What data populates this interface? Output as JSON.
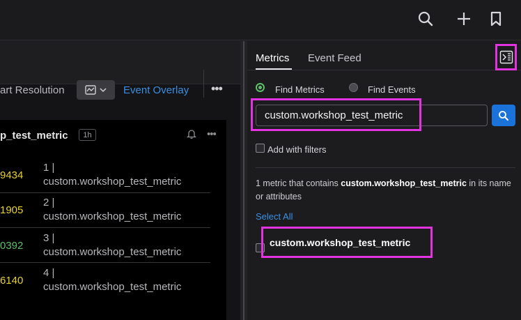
{
  "colors": {
    "accent_blue": "#1b73d9",
    "link_blue": "#3b8fe3",
    "highlight_magenta": "#e233e0",
    "value_yellow": "#e6d12a",
    "value_green": "#5fbf6a"
  },
  "topbar": {
    "icons": [
      "search-icon",
      "plus-icon",
      "bookmark-icon"
    ]
  },
  "toolbar": {
    "chart_resolution_label": "art Resolution",
    "event_overlay_label": "Event Overlay",
    "more_label": "•••"
  },
  "chart": {
    "title": "p_test_metric",
    "range_badge": "1h",
    "more_label": "•••",
    "rows": [
      {
        "value": "9434",
        "index": "1 |",
        "name": "custom.workshop_test_metric",
        "color": "#e6d12a"
      },
      {
        "value": "1905",
        "index": "2 |",
        "name": "custom.workshop_test_metric",
        "color": "#e6d12a"
      },
      {
        "value": "0392",
        "index": "3 |",
        "name": "custom.workshop_test_metric",
        "color": "#5fbf6a"
      },
      {
        "value": "6140",
        "index": "4 |",
        "name": "custom.workshop_test_metric",
        "color": "#e6d12a"
      }
    ]
  },
  "panel": {
    "tabs": [
      "Metrics",
      "Event Feed"
    ],
    "active_tab": "Metrics",
    "radio_find_metrics": "Find Metrics",
    "radio_find_events": "Find Events",
    "search_value": "custom.workshop_test_metric",
    "add_with_filters": "Add with filters",
    "result_prefix": "1 metric that contains ",
    "result_term": "custom.workshop_test_metric",
    "result_suffix": " in its name or attributes",
    "select_all": "Select All",
    "result_item": "custom.workshop_test_metric"
  }
}
